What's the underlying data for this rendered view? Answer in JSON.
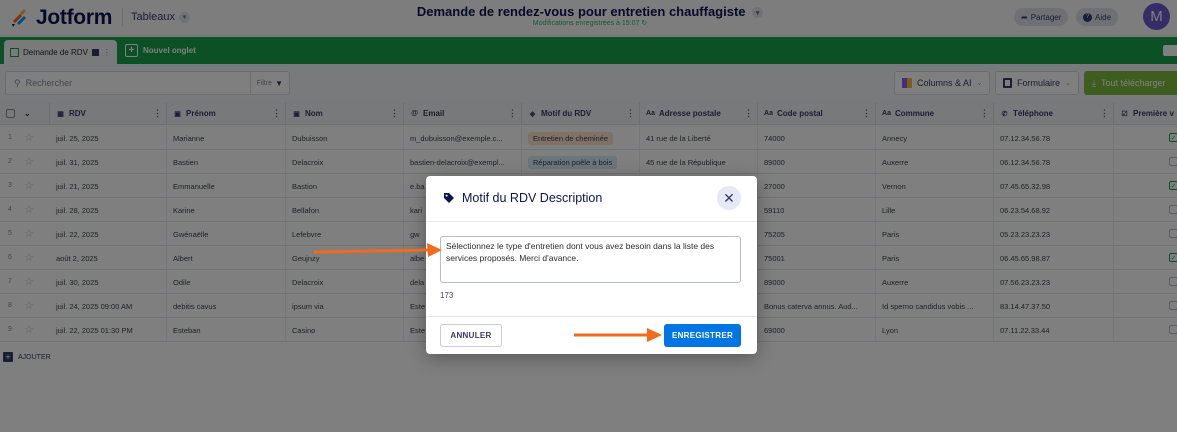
{
  "header": {
    "brand": "Jotform",
    "tables_selector": "Tableaux",
    "form_title": "Demande de rendez-vous pour entretien chauffagiste",
    "saved_note": "Modifications enregistrées à 15:07",
    "share_label": "Partager",
    "help_label": "Aide",
    "avatar_initial": "M"
  },
  "tabs": {
    "active_tab": "Demande de RDV",
    "new_tab": "Nouvel onglet"
  },
  "toolbar": {
    "search_placeholder": "Rechercher",
    "filter_label": "Filtre",
    "columns_label": "Columns & AI",
    "form_label": "Formulaire",
    "download_label": "Tout télécharger"
  },
  "table": {
    "columns": [
      "RDV",
      "Prénom",
      "Nom",
      "Email",
      "Motif du RDV",
      "Adresse postale",
      "Code postal",
      "Commune",
      "Téléphone",
      "Première v"
    ],
    "rows": [
      {
        "num": "1",
        "rdv": "juil. 25, 2025",
        "prenom": "Marianne",
        "nom": "Dubuisson",
        "email": "m_dubuisson@exemple.c...",
        "motif": "Entretien de cheminée",
        "adresse": "41 rue de la Liberté",
        "code": "74000",
        "commune": "Annecy",
        "tel": "07.12.34.56.78",
        "check": true
      },
      {
        "num": "2",
        "rdv": "juil. 31, 2025",
        "prenom": "Bastien",
        "nom": "Delacroix",
        "email": "bastien-delacroix@exempl...",
        "motif": "Réparation poêle à bois",
        "adresse": "45 rue de la République",
        "code": "89000",
        "commune": "Auxerre",
        "tel": "06.12.34.56.78",
        "check": false
      },
      {
        "num": "3",
        "rdv": "juil. 21, 2025",
        "prenom": "Emmanuelle",
        "nom": "Bastion",
        "email": "e.ba",
        "motif": "",
        "adresse": "",
        "code": "27000",
        "commune": "Vernon",
        "tel": "07.45.65.32.98",
        "check": true
      },
      {
        "num": "4",
        "rdv": "juil. 28, 2025",
        "prenom": "Karine",
        "nom": "Bellafon",
        "email": "kari",
        "motif": "",
        "adresse": "",
        "code": "59110",
        "commune": "Lille",
        "tel": "06.23.54.68.92",
        "check": false
      },
      {
        "num": "5",
        "rdv": "juil. 22, 2025",
        "prenom": "Gwénaëlle",
        "nom": "Lefebvre",
        "email": "gw",
        "motif": "",
        "adresse": "",
        "code": "75205",
        "commune": "Paris",
        "tel": "05.23.23.23.23",
        "check": false
      },
      {
        "num": "6",
        "rdv": "août 2, 2025",
        "prenom": "Albert",
        "nom": "Geujnzy",
        "email": "albe",
        "motif": "",
        "adresse": "",
        "code": "75001",
        "commune": "Paris",
        "tel": "06.45.65.98.87",
        "check": true
      },
      {
        "num": "7",
        "rdv": "juil. 30, 2025",
        "prenom": "Odile",
        "nom": "Delacroix",
        "email": "dela",
        "motif": "",
        "adresse": "",
        "code": "89000",
        "commune": "Auxerre",
        "tel": "07.56.23.23.23",
        "check": false
      },
      {
        "num": "8",
        "rdv": "juil. 24, 2025 09:00 AM",
        "prenom": "debitis cavus",
        "nom": "ipsum via",
        "email": "Este",
        "motif": "",
        "adresse": "",
        "code": "Bonus caterva annus. Aud...",
        "commune": "Id sperno candidus vobis ...",
        "tel": "83.14.47.37.50",
        "check": false
      },
      {
        "num": "9",
        "rdv": "juil. 22, 2025 01:30 PM",
        "prenom": "Esteban",
        "nom": "Casino",
        "email": "Este",
        "motif": "",
        "adresse": "",
        "code": "69000",
        "commune": "Lyon",
        "tel": "07.11.22.33.44",
        "check": false
      }
    ],
    "add_label": "AJOUTER"
  },
  "modal": {
    "title": "Motif du RDV Description",
    "textarea_value": "Sélectionnez le type d'entretien dont vous avez besoin dans la liste des services proposés. Merci d'avance.",
    "char_count": "173",
    "cancel_label": "ANNULER",
    "save_label": "ENREGISTRER"
  },
  "colors": {
    "brand_green": "#16a24a",
    "save_blue": "#0075e3",
    "arrow_orange": "#f26a1b",
    "tag_orange_bg": "#fde2cc",
    "tag_blue_bg": "#d7ecf5"
  }
}
